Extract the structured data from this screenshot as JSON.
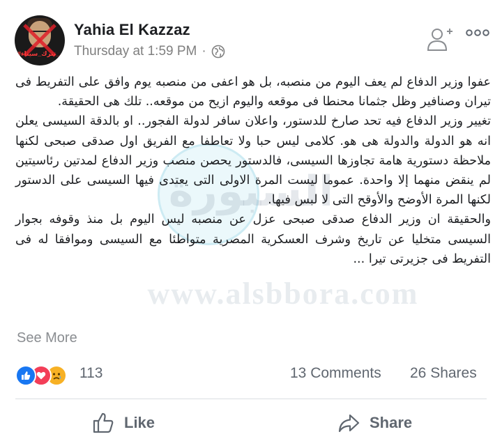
{
  "post": {
    "author": "Yahia El Kazzaz",
    "avatar_tag": "#لن_تترك_سيناء",
    "timestamp": "Thursday at 1:59 PM",
    "separator": "·",
    "privacy_icon": "globe-icon",
    "paragraphs": [
      "عفوا وزير الدفاع لم يعف اليوم من منصبه، بل هو اعفى من منصبه يوم وافق على التفريط فى تيران وصنافير وظل جثمانا محنطا فى موقعه واليوم ازيح من موقعه.. تلك هى الحقيقة.",
      "تغيير وزير الدفاع فيه تحد صارخ للدستور، واعلان سافر لدولة الفجور.. او بالدقة السيسى يعلن انه هو الدولة والدولة هى هو. كلامى ليس حبا ولا تعاطفا مع الفريق اول صدقى صبحى لكنها ملاحظة دستورية هامة تجاوزها السيسى، فالدستور يحصن منصب وزير الدفاع لمدتين رئاسيتين لم ينقض منهما إلا واحدة. عموما ليست المرة الاولى التى يعتدى فيها السيسى على الدستور لكنها المرة الأوضح والأوقح التى لا لبس فيها.",
      "والحقيقة ان وزير الدفاع صدقى صبحى عزل عن منصبه ليس اليوم بل منذ وقوفه بجوار السيسى متخليا عن تاريخ وشرف العسكرية المصرية متواطئا مع السيسى وموافقا له فى التفريط فى جزيرتى تيرا ..."
    ],
    "see_more": "See More"
  },
  "watermark": {
    "word": "السبورة",
    "url": "www.alsbbora.com"
  },
  "engagement": {
    "reaction_icons": [
      "like-reaction-icon",
      "love-reaction-icon",
      "sad-reaction-icon"
    ],
    "reaction_count": "113",
    "comments": "13 Comments",
    "shares": "26 Shares"
  },
  "actions": {
    "like": "Like",
    "share": "Share"
  },
  "colors": {
    "like_blue": "#1877f2",
    "love_red": "#f33e58",
    "sad_yellow": "#f7b125",
    "muted_text": "#606770"
  }
}
